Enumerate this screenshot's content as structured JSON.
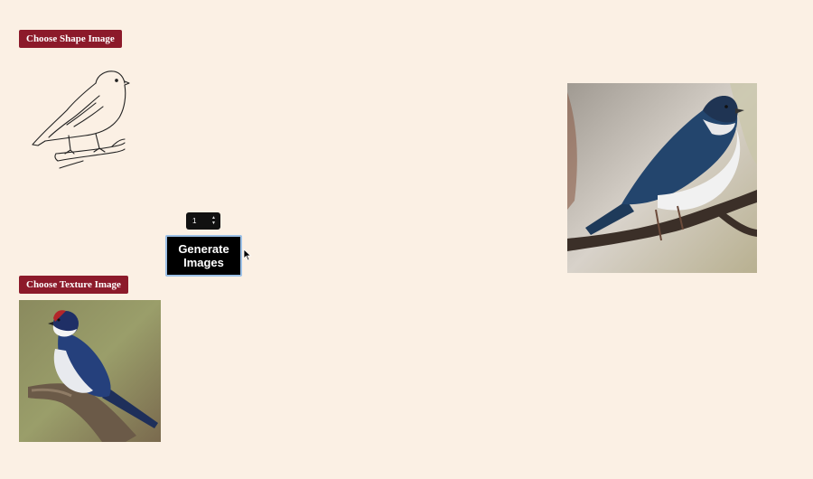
{
  "shape": {
    "button_label": "Choose Shape Image",
    "image_icon": "bird-outline-sketch"
  },
  "texture": {
    "button_label": "Choose Texture Image",
    "image_icon": "swallow-photo"
  },
  "controls": {
    "count_value": "1",
    "generate_label_line1": "Generate",
    "generate_label_line2": "Images"
  },
  "result": {
    "image_icon": "generated-bird-photo"
  },
  "colors": {
    "background": "#fbf0e4",
    "choose_button": "#8c1a2a",
    "generate_button": "#000000",
    "generate_border": "#9cc0e6"
  }
}
